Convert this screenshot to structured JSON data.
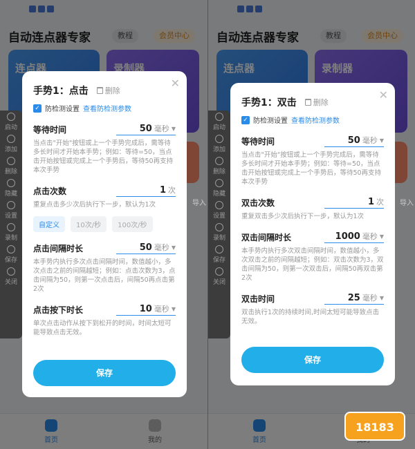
{
  "app": {
    "title": "自动连点器专家",
    "tutorial": "教程",
    "vip": "会员中心",
    "card1": "连点器",
    "card2": "录制器",
    "import_label": "导入"
  },
  "toolbar": [
    "启动",
    "添加",
    "删除",
    "隐藏",
    "设置",
    "录制",
    "保存",
    "关闭"
  ],
  "nav": {
    "home": "首页",
    "mine": "我的"
  },
  "left_dialog": {
    "title": "手势1：点击",
    "delete": "删除",
    "anti_label": "防检测设置",
    "anti_link": "查看防检测参数",
    "wait": {
      "label": "等待时间",
      "value": "50",
      "unit": "毫秒",
      "desc": "当点击\"开始\"按钮或上一个手势完成后，需等待多长时间才开始本手势；例如：等待=50，当点击开始按钮或完成上一个手势后，等待50再支持本次手势"
    },
    "count": {
      "label": "点击次数",
      "value": "1",
      "unit": "次",
      "desc": "重复点击多少次后执行下一步，默认为1次"
    },
    "speeds": [
      "自定义",
      "10次/秒",
      "100次/秒"
    ],
    "interval": {
      "label": "点击间隔时长",
      "value": "50",
      "unit": "毫秒",
      "desc": "本手势内执行多次点击间隔时间，数值越小，多次点击之前的间隔越短；例如：点击次数为3，点击间隔为50，则第一次点击后，间隔50再点击第2次"
    },
    "press": {
      "label": "点击按下时长",
      "value": "10",
      "unit": "毫秒",
      "desc": "单次点击动作从按下到松开的时间，时间太短可能导致点击无效。"
    },
    "save": "保存"
  },
  "right_dialog": {
    "title": "手势1：双击",
    "delete": "删除",
    "anti_label": "防检测设置",
    "anti_link": "查看防检测参数",
    "wait": {
      "label": "等待时间",
      "value": "50",
      "unit": "毫秒",
      "desc": "当点击\"开始\"按钮或上一个手势完成后，需等待多长时间才开始本手势；例如：等待=50，当点击开始按钮或完成上一个手势后，等待50再支持本次手势"
    },
    "count": {
      "label": "双击次数",
      "value": "1",
      "unit": "次",
      "desc": "重复双击多少次后执行下一步，默认为1次"
    },
    "interval": {
      "label": "双击间隔时长",
      "value": "1000",
      "unit": "毫秒",
      "desc": "本手势内执行多次双击间隔时间，数值越小，多次双击之前的间隔越短；例如：双击次数为3，双击间隔为50，则第一次双击后，间隔50再双击第2次"
    },
    "dbl": {
      "label": "双击时间",
      "value": "25",
      "unit": "毫秒",
      "desc": "双击执行1次的持续时间,时间太短可能导致点击无效。"
    },
    "save": "保存"
  },
  "watermark": "18183"
}
